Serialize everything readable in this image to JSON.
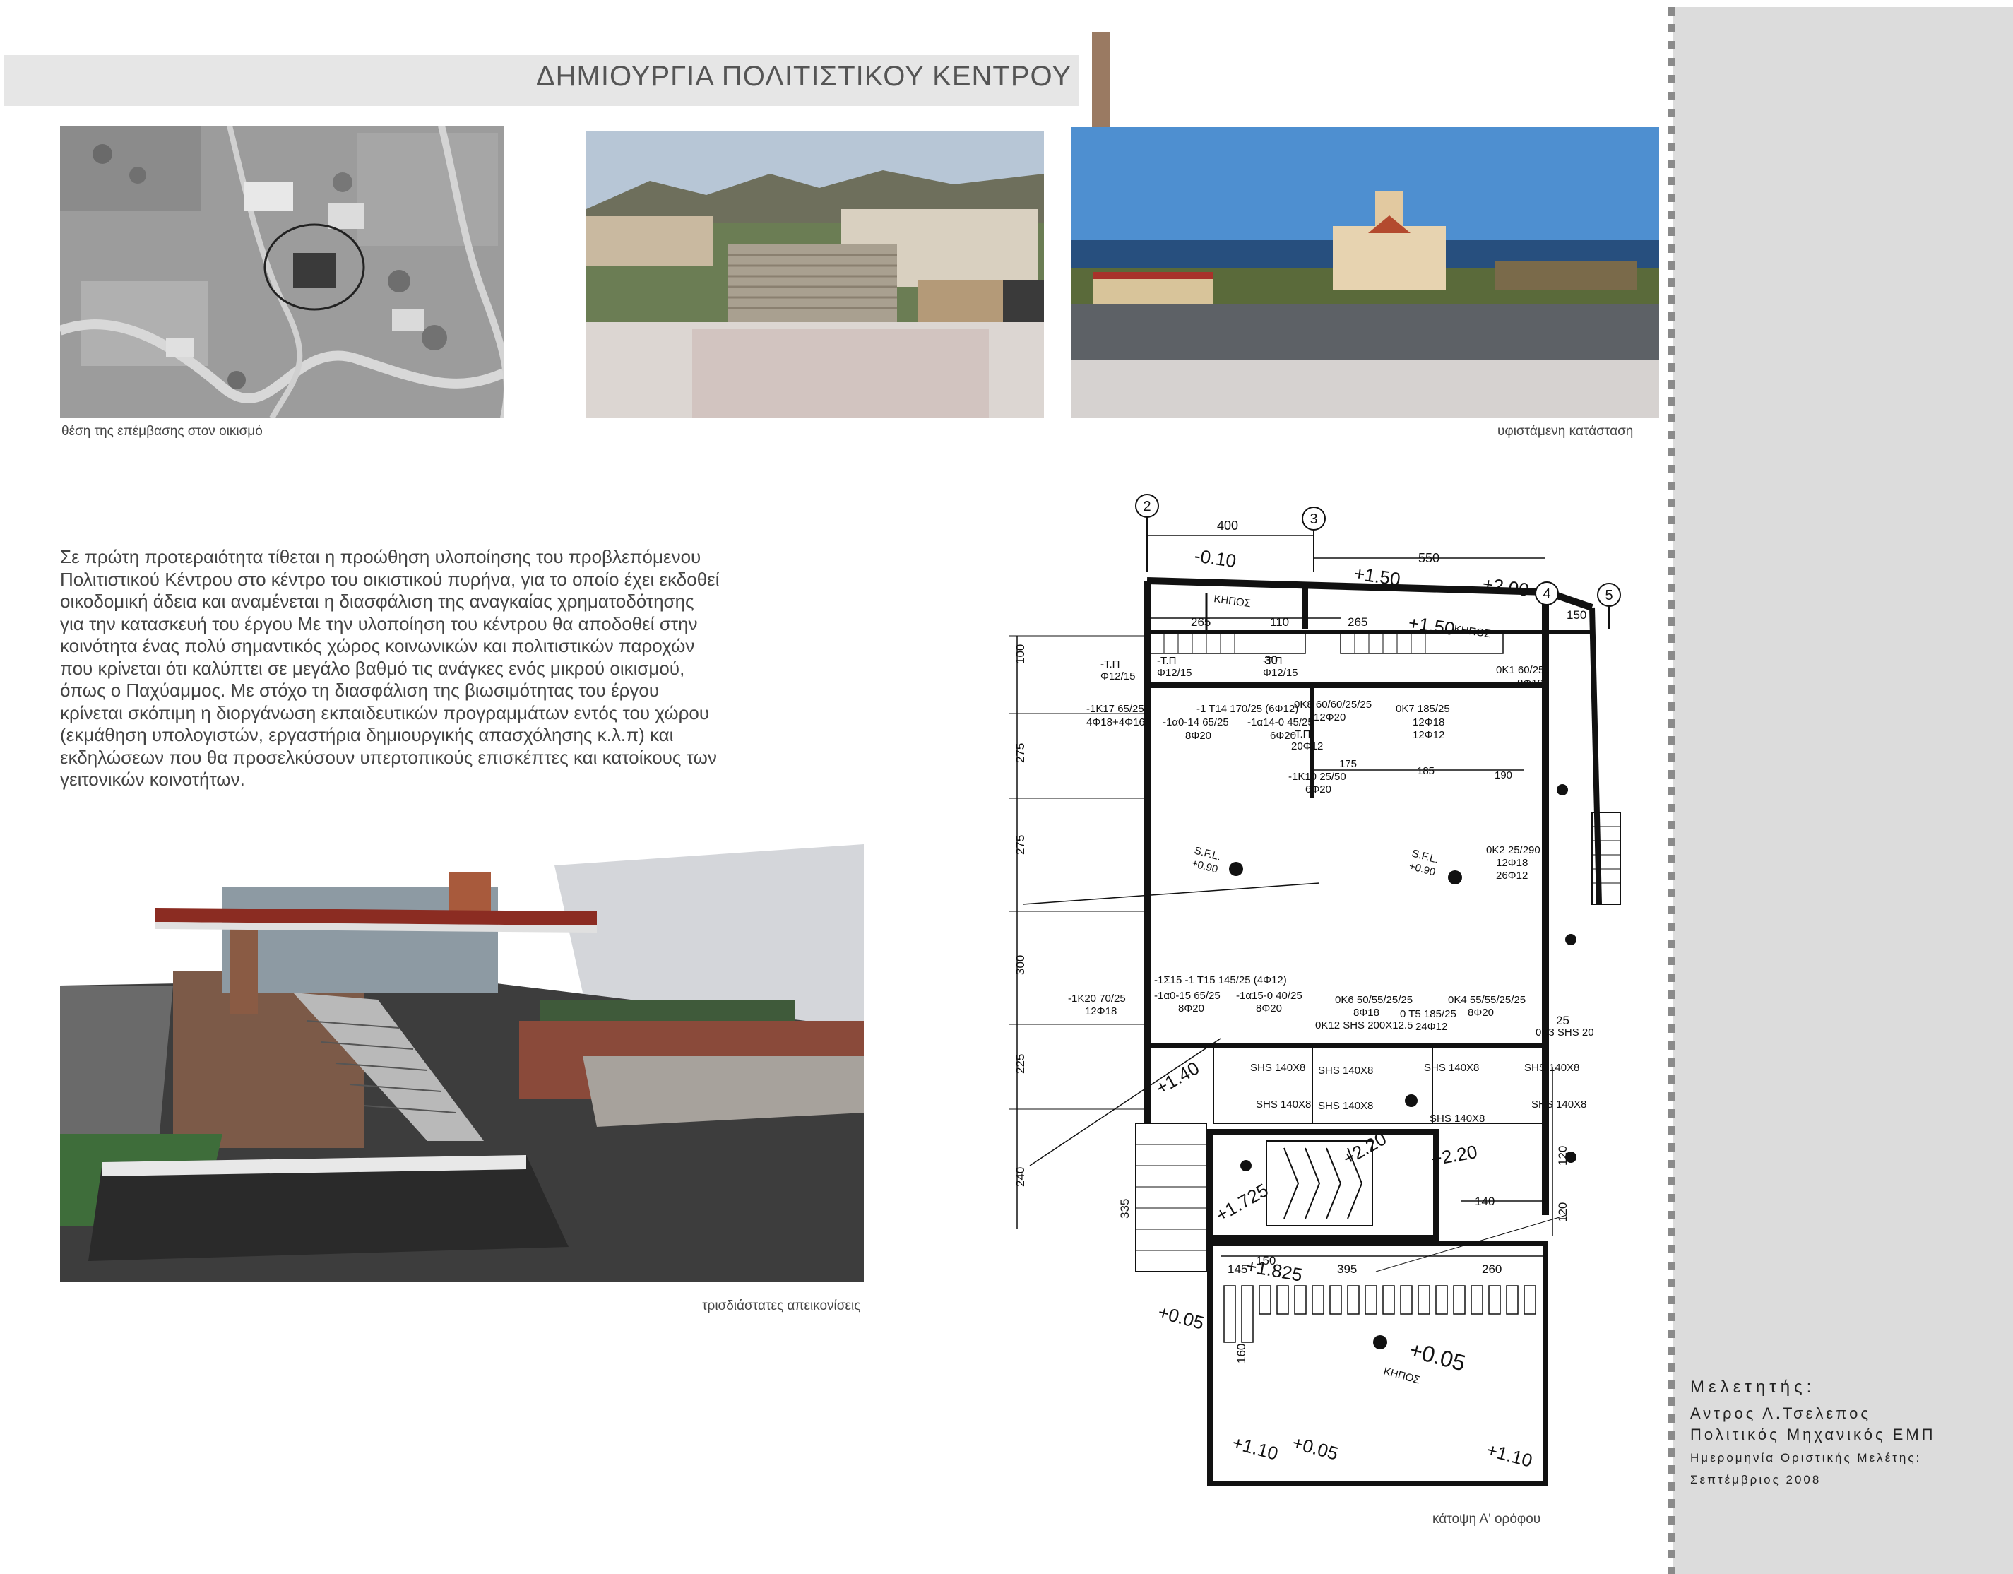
{
  "header": {
    "title": "ΔΗΜΙΟΥΡΓΙΑ ΠΟΛΙΤΙΣΤΙΚΟΥ ΚΕΝΤΡΟΥ"
  },
  "captions": {
    "aerial": "θέση της επέμβασης στον οικισμό",
    "existing": "υφιστάμενη κατάσταση",
    "render": "τρισδιάστατες απεικονίσεις",
    "plan": "κάτοψη Α' ορόφου"
  },
  "body_lines": [
    "Σε πρώτη προτεραιότητα τίθεται η προώθηση υλοποίησης του προβλεπόμενου",
    "Πολιτιστικού Κέντρου στο κέντρο του οικιστικού πυρήνα, για το οποίο έχει εκδοθεί",
    "οικοδομική άδεια και αναμένεται η διασφάλιση της αναγκαίας χρηματοδότησης",
    "για την κατασκευή του έργου  Με την υλοποίηση του κέντρου θα αποδοθεί στην",
    "κοινότητα ένας πολύ σημαντικός χώρος κοινωνικών και πολιτιστικών παροχών",
    "που κρίνεται ότι καλύπτει σε μεγάλο βαθμό τις ανάγκες ενός μικρού οικισμού,",
    "όπως ο Παχύαμμος. Με στόχο τη διασφάλιση της βιωσιμότητας του έργου",
    "κρίνεται σκόπιμη η διοργάνωση εκπαιδευτικών προγραμμάτων εντός του χώρου",
    "(εκμάθηση υπολογιστών, εργαστήρια δημιουργικής απασχόλησης κ.λ.π) και",
    "εκδηλώσεων που θα προσελκύσουν υπερτοπικούς επισκέπτες και κατοίκους των",
    "γειτονικών κοινοτήτων."
  ],
  "plan_labels": {
    "axis_2": "2",
    "axis_3": "3",
    "axis_4": "4",
    "axis_5": "5",
    "dim_400": "400",
    "dim_550": "550",
    "dim_150": "150",
    "dim_265a": "265",
    "dim_110": "110",
    "dim_265b": "265",
    "dim_100": "100",
    "dim_275a": "275",
    "dim_275b": "275",
    "dim_300": "300",
    "dim_225": "225",
    "dim_240": "240",
    "dim_335": "335",
    "dim_145": "145",
    "dim_395": "395",
    "dim_260": "260",
    "dim_140": "140",
    "dim_120a": "120",
    "dim_120b": "120",
    "dim_160": "160",
    "lvl_m010": "-0.10",
    "lvl_150a": "+1.50",
    "lvl_150b": "+1.50",
    "lvl_200": "+2.00",
    "kipos_a": "ΚΗΠΟΣ",
    "kipos_b": "ΚΗΠΟΣ",
    "kipos_c": "ΚΗΠΟΣ",
    "tp_a": "-Τ.Π",
    "phi_a": "Φ12/15",
    "tp_b": "-Τ.Π",
    "phi_b": "Φ12/15",
    "tp_c": "-Τ.Π",
    "phi_c": "Φ12/15",
    "ok1": "0Κ1 60/25",
    "ok1r": "8Φ18",
    "k17": "-1Κ17 65/25",
    "k17r": "4Φ18+4Φ16",
    "a14": "-1α0-14 65/25",
    "a14r": "8Φ20",
    "t14": "-1 Τ14 170/25 (6Φ12)",
    "a14b": "-1α14-0 45/25",
    "a14br": "6Φ20",
    "ok8": "0Κ8 60/60/25/25",
    "ok8r": "12Φ20",
    "ok7": "0Κ7 185/25",
    "ok7r1": "12Φ18",
    "ok7r2": "12Φ12",
    "tp_d": "-Τ.Π",
    "phi_d": "20Φ12",
    "k10": "-1Κ10 25/50",
    "k10r": "6Φ20",
    "dim_175": "175",
    "dim_185": "185",
    "dim_190": "190",
    "sfl_a": "S.F.L.",
    "sfl_a_v": "+0.90",
    "sfl_b": "S.F.L.",
    "sfl_b_v": "+0.90",
    "ok2": "0Κ2 25/290",
    "ok2r1": "12Φ18",
    "ok2r2": "26Φ12",
    "s15": "-1Σ15  -1 Τ15 145/25  (4Φ12)",
    "a15": "-1α0-15 65/25",
    "a15r": "8Φ20",
    "a15b": "-1α15-0 40/25",
    "a15br": "8Φ20",
    "k20": "-1Κ20 70/25",
    "k20r": "12Φ18",
    "ok6": "0Κ6 50/55/25/25",
    "ok6r": "8Φ18",
    "t5": "0 Τ5 185/25",
    "t5r": "24Φ12",
    "ok4": "0Κ4 55/55/25/25",
    "ok4r": "8Φ20",
    "ok12": "0Κ12 SHS 200X12.5",
    "ok3": "0Κ3 SHS 20",
    "shs1": "SHS 140X8",
    "shs2": "SHS 140X8",
    "shs3": "SHS 140X8",
    "shs4": "SHS 140X8",
    "shs5": "SHS 140X8",
    "shs6": "SHS 140X8",
    "shs7": "SHS 140X8",
    "shs8": "SHS 140X8",
    "lvl_140": "+1.40",
    "lvl_220a": "+2.20",
    "lvl_220b": "+2.20",
    "lvl_1725": "+1.725",
    "lvl_1825": "+1.825",
    "lvl_005a": "+0.05",
    "lvl_005b": "+0.05",
    "lvl_005c": "+0.05",
    "lvl_110a": "+1.10",
    "lvl_110b": "+1.10",
    "dim_25": "25",
    "dim_30": "30"
  },
  "sidebar": {
    "designer_heading": "Μελετητής:",
    "designer_name": "Αντρος Λ.Τσελεπος",
    "designer_title": "Πολιτικός Μηχανικός ΕΜΠ",
    "date_label": "Ημερομηνία Οριστικής Μελέτης:",
    "date_value": "Σεπτέμβριος 2008"
  }
}
